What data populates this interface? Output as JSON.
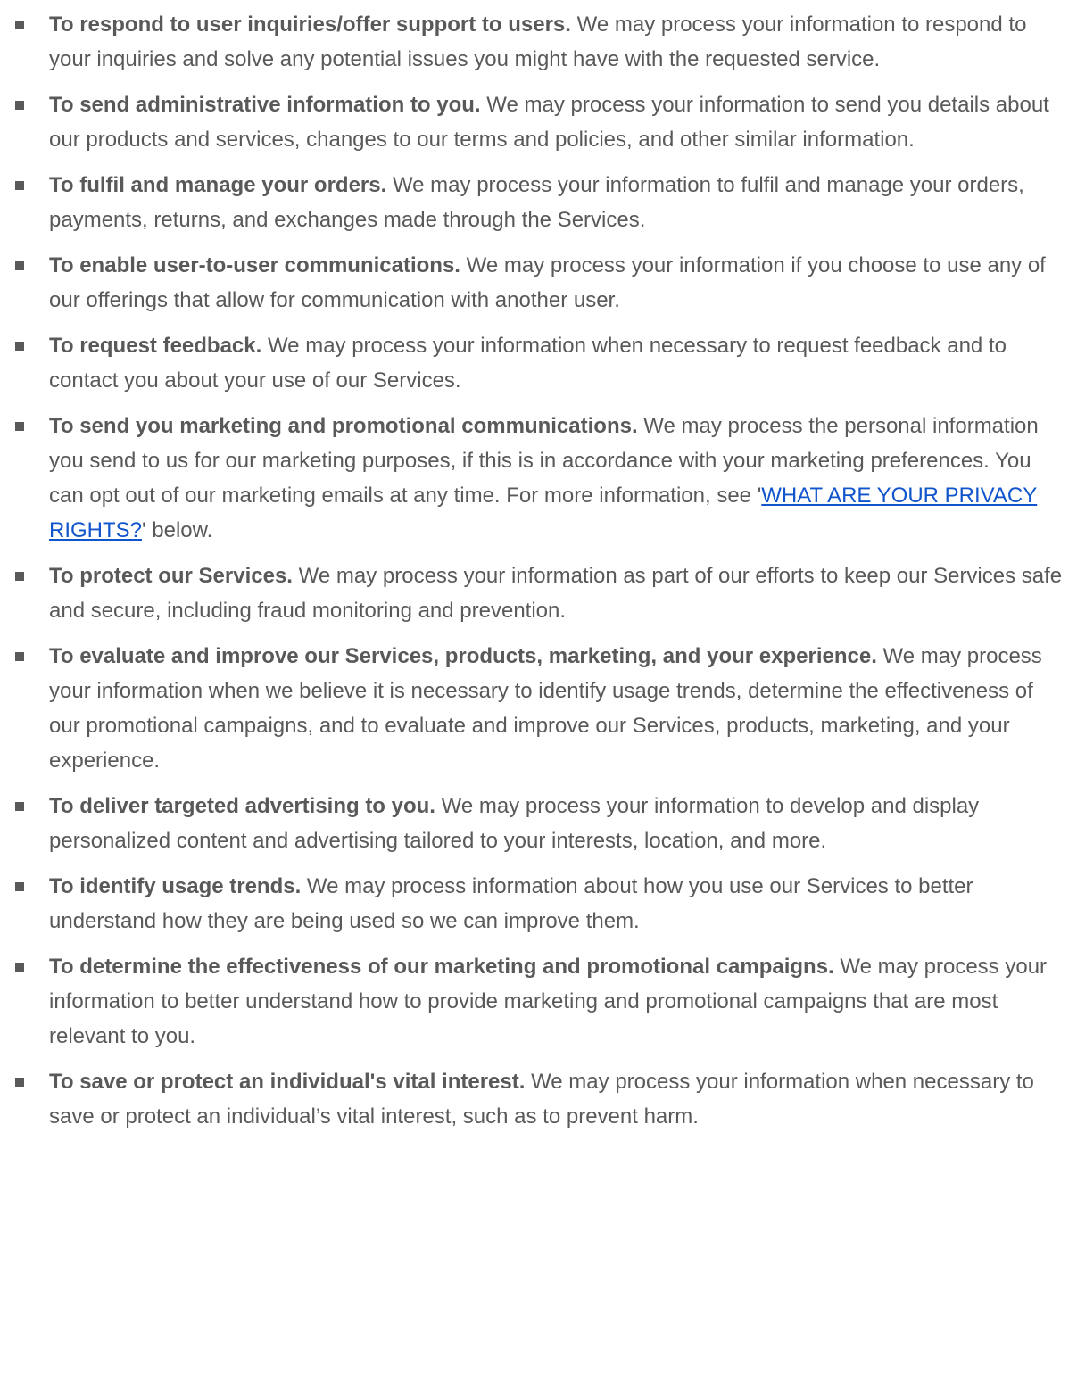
{
  "items": [
    {
      "bold": "To respond to user inquiries/offer support to users.",
      "text": " We may process your information to respond to your inquiries and solve any potential issues you might have with the requested service."
    },
    {
      "bold": "To send administrative information to you.",
      "text": " We may process your information to send you details about our products and services, changes to our terms and policies, and other similar information."
    },
    {
      "bold": "To fulfil and manage your orders.",
      "text": " We may process your information to fulfil and manage your orders, payments, returns, and exchanges made through the Services."
    },
    {
      "bold": "To enable user-to-user communications.",
      "text": " We may process your information if you choose to use any of our offerings that allow for communication with another user."
    },
    {
      "bold": "To request feedback.",
      "text": " We may process your information when necessary to request feedback and to contact you about your use of our Services."
    },
    {
      "bold": "To send you marketing and promotional communications.",
      "text": " We may process the personal information you send to us for our marketing purposes, if this is in accordance with your marketing preferences. You can opt out of our marketing emails at any time. For more information, see '",
      "link": "WHAT ARE YOUR PRIVACY RIGHTS?",
      "after": "' below."
    },
    {
      "bold": "To protect our Services.",
      "text": " We may process your information as part of our efforts to keep our Services safe and secure, including fraud monitoring and prevention."
    },
    {
      "bold": "To evaluate and improve our Services, products, marketing, and your experience.",
      "text": " We may process your information when we believe it is necessary to identify usage trends, determine the effectiveness of our promotional campaigns, and to evaluate and improve our Services, products, marketing, and your experience."
    },
    {
      "bold": "To deliver targeted advertising to you.",
      "text": " We may process your information to develop and display personalized content and advertising tailored to your interests, location, and more."
    },
    {
      "bold": "To identify usage trends.",
      "text": " We may process information about how you use our Services to better understand how they are being used so we can improve them."
    },
    {
      "bold": "To determine the effectiveness of our marketing and promotional campaigns.",
      "text": " We may process your information to better understand how to provide marketing and promotional campaigns that are most relevant to you."
    },
    {
      "bold": "To save or protect an individual's vital interest.",
      "text": " We may process your information when necessary to save or protect an individual’s vital interest, such as to prevent harm."
    }
  ],
  "colors": {
    "text": "#595959",
    "link": "#1155cc",
    "background": "#ffffff"
  },
  "icons": {
    "bullet": "square-bullet-icon"
  }
}
